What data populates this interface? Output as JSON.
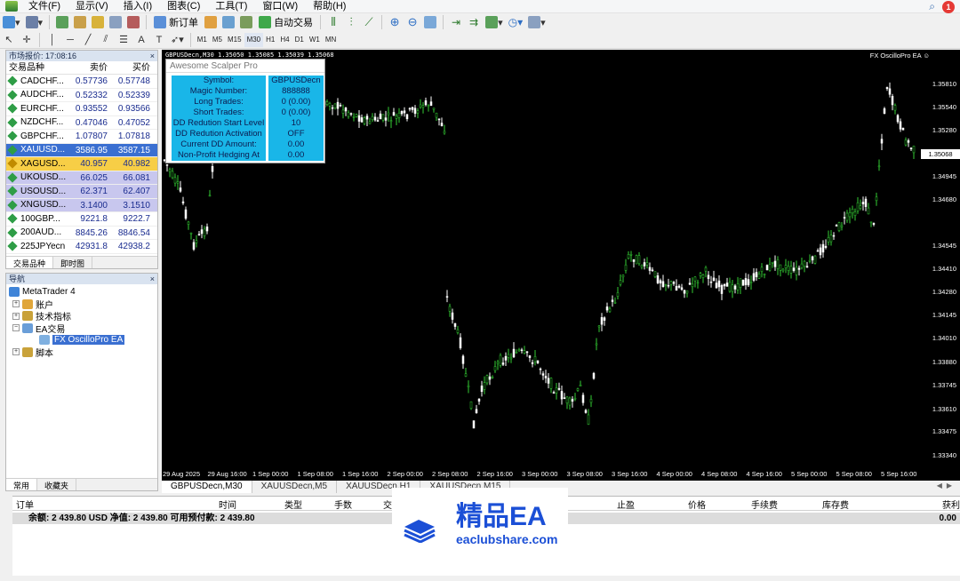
{
  "menu": [
    "文件(F)",
    "显示(V)",
    "插入(I)",
    "图表(C)",
    "工具(T)",
    "窗口(W)",
    "帮助(H)"
  ],
  "toolbar": {
    "new_order": "新订单",
    "auto_trading": "自动交易",
    "timeframes": [
      "M1",
      "M5",
      "M15",
      "M30",
      "H1",
      "H4",
      "D1",
      "W1",
      "MN"
    ]
  },
  "notifications": {
    "count": "1"
  },
  "market_watch": {
    "title": "市场报价: 17:08:16",
    "columns": [
      "交易品种",
      "卖价",
      "买价"
    ],
    "rows": [
      {
        "symbol": "CADCHF...",
        "bid": "0.57736",
        "ask": "0.57748",
        "style": "",
        "color": "#2e9d46"
      },
      {
        "symbol": "AUDCHF...",
        "bid": "0.52332",
        "ask": "0.52339",
        "style": "",
        "color": "#2e9d46"
      },
      {
        "symbol": "EURCHF...",
        "bid": "0.93552",
        "ask": "0.93566",
        "style": "",
        "color": "#2e9d46"
      },
      {
        "symbol": "NZDCHF...",
        "bid": "0.47046",
        "ask": "0.47052",
        "style": "",
        "color": "#2e9d46"
      },
      {
        "symbol": "GBPCHF...",
        "bid": "1.07807",
        "ask": "1.07818",
        "style": "",
        "color": "#2e9d46"
      },
      {
        "symbol": "XAUUSD...",
        "bid": "3586.95",
        "ask": "3587.15",
        "style": "sel",
        "color": "#2e9d46"
      },
      {
        "symbol": "XAGUSD...",
        "bid": "40.957",
        "ask": "40.982",
        "style": "hl",
        "color": "#c18b00"
      },
      {
        "symbol": "UKOUSD...",
        "bid": "66.025",
        "ask": "66.081",
        "style": "lav",
        "color": "#2e9d46"
      },
      {
        "symbol": "USOUSD...",
        "bid": "62.371",
        "ask": "62.407",
        "style": "lav",
        "color": "#2e9d46"
      },
      {
        "symbol": "XNGUSD...",
        "bid": "3.1400",
        "ask": "3.1510",
        "style": "lav",
        "color": "#2e9d46"
      },
      {
        "symbol": "100GBP...",
        "bid": "9221.8",
        "ask": "9222.7",
        "style": "",
        "color": "#2e9d46"
      },
      {
        "symbol": "200AUD...",
        "bid": "8845.26",
        "ask": "8846.54",
        "style": "",
        "color": "#2e9d46"
      },
      {
        "symbol": "225JPYecn",
        "bid": "42931.8",
        "ask": "42938.2",
        "style": "",
        "color": "#2e9d46"
      }
    ],
    "tabs": [
      "交易品种",
      "即时图"
    ]
  },
  "navigator": {
    "title": "导航",
    "root": "MetaTrader 4",
    "items": [
      "账户",
      "技术指标",
      "EA交易",
      "FX OscilloPro EA",
      "脚本"
    ],
    "tabs": [
      "常用",
      "收藏夹"
    ]
  },
  "chart": {
    "header": "GBPUSDecn,M30  1.35050 1.35085 1.35039 1.35068",
    "ea_label": "FX OscilloPro EA ☺",
    "current_price": "1.35068",
    "price_labels": [
      "1.35810",
      "1.35540",
      "1.35280",
      "1.35068",
      "1.34945",
      "1.34680",
      "1.34545",
      "1.34410",
      "1.34280",
      "1.34145",
      "1.34010",
      "1.33880",
      "1.33745",
      "1.33610",
      "1.33475",
      "1.33340"
    ],
    "time_labels": [
      "29 Aug 2025",
      "29 Aug 16:00",
      "1 Sep 00:00",
      "1 Sep 08:00",
      "1 Sep 16:00",
      "2 Sep 00:00",
      "2 Sep 08:00",
      "2 Sep 16:00",
      "3 Sep 00:00",
      "3 Sep 08:00",
      "3 Sep 16:00",
      "4 Sep 00:00",
      "4 Sep 08:00",
      "4 Sep 16:00",
      "5 Sep 00:00",
      "5 Sep 08:00",
      "5 Sep 16:00"
    ],
    "colors": {
      "bull": "#33cc33",
      "bear": "#ffffff",
      "bg": "#000000"
    }
  },
  "ea_panel": {
    "title": "Awesome Scalper Pro",
    "rows": [
      {
        "label": "Symbol:",
        "value": "GBPUSDecn"
      },
      {
        "label": "Magic Number:",
        "value": "888888"
      },
      {
        "label": "Long Trades:",
        "value": "0 (0.00)"
      },
      {
        "label": "Short Trades:",
        "value": "0 (0.00)"
      },
      {
        "label": "DD Redution Start Level",
        "value": "10"
      },
      {
        "label": "DD Redution Activation",
        "value": "OFF"
      },
      {
        "label": "Current DD Amount:",
        "value": "0.00"
      },
      {
        "label": "Non-Profit Hedging At",
        "value": "0.00"
      }
    ]
  },
  "chart_tabs": [
    "GBPUSDecn,M30",
    "XAUUSDecn,M5",
    "XAUUSDecn,H1",
    "XAUUSDecn,M15"
  ],
  "terminal": {
    "columns": [
      "订单",
      "时间",
      "类型",
      "手数",
      "交",
      "止盈",
      "价格",
      "手续费",
      "库存费",
      "获利"
    ],
    "balance": "余额: 2 439.80 USD  净值: 2 439.80  可用预付款: 2 439.80",
    "profit": "0.00"
  },
  "watermark": {
    "title": "精品EA",
    "url": "eaclubshare.com"
  }
}
